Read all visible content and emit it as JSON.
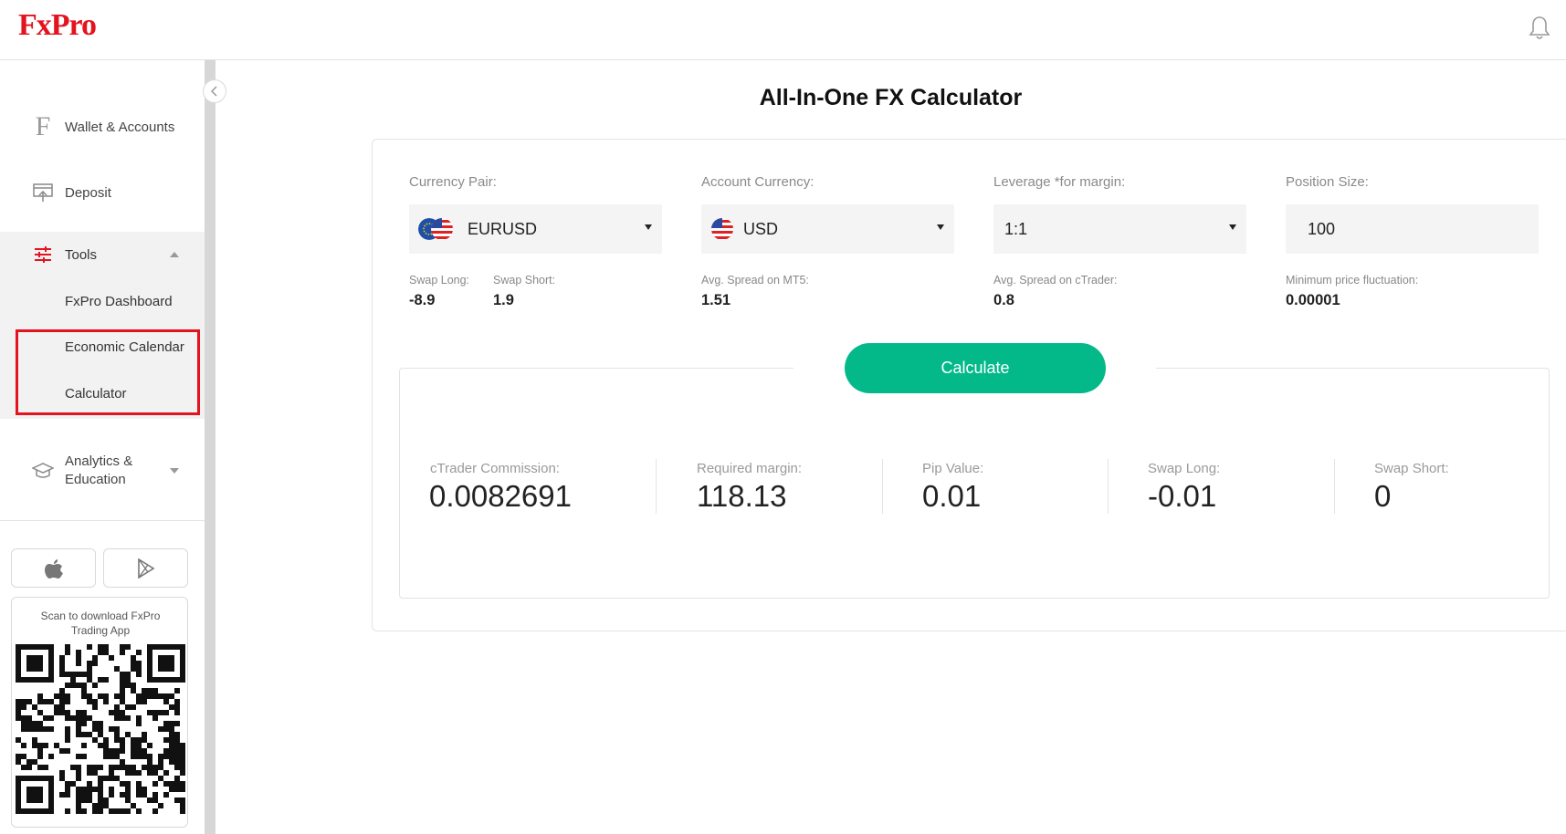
{
  "header": {
    "logo": "FxPro"
  },
  "sidebar": {
    "items": [
      {
        "label": "Wallet & Accounts"
      },
      {
        "label": "Deposit"
      },
      {
        "label": "Tools"
      },
      {
        "label": "Analytics & Education"
      }
    ],
    "tools_subitems": [
      {
        "label": "FxPro Dashboard"
      },
      {
        "label": "Economic Calendar"
      },
      {
        "label": "Calculator"
      }
    ],
    "qr_text": "Scan to download FxPro Trading App"
  },
  "main": {
    "title": "All-In-One FX Calculator",
    "fields": {
      "currency_pair": {
        "label": "Currency Pair:",
        "value": "EURUSD"
      },
      "account_currency": {
        "label": "Account Currency:",
        "value": "USD"
      },
      "leverage": {
        "label": "Leverage *for margin:",
        "value": "1:1"
      },
      "position_size": {
        "label": "Position Size:",
        "value": "100"
      }
    },
    "info": {
      "swap_long": {
        "label": "Swap Long:",
        "value": "-8.9"
      },
      "swap_short": {
        "label": "Swap Short:",
        "value": "1.9"
      },
      "avg_spread_mt5": {
        "label": "Avg. Spread on MT5:",
        "value": "1.51"
      },
      "avg_spread_ctrader": {
        "label": "Avg. Spread on cTrader:",
        "value": "0.8"
      },
      "min_fluctuation": {
        "label": "Minimum price fluctuation:",
        "value": "0.00001"
      }
    },
    "calculate_label": "Calculate",
    "results": [
      {
        "label": "cTrader Commission:",
        "value": "0.0082691"
      },
      {
        "label": "Required margin:",
        "value": "118.13"
      },
      {
        "label": "Pip Value:",
        "value": "0.01"
      },
      {
        "label": "Swap Long:",
        "value": "-0.01"
      },
      {
        "label": "Swap Short:",
        "value": "0"
      }
    ]
  },
  "colors": {
    "brand": "#e3141f",
    "accent": "#03b98a"
  }
}
